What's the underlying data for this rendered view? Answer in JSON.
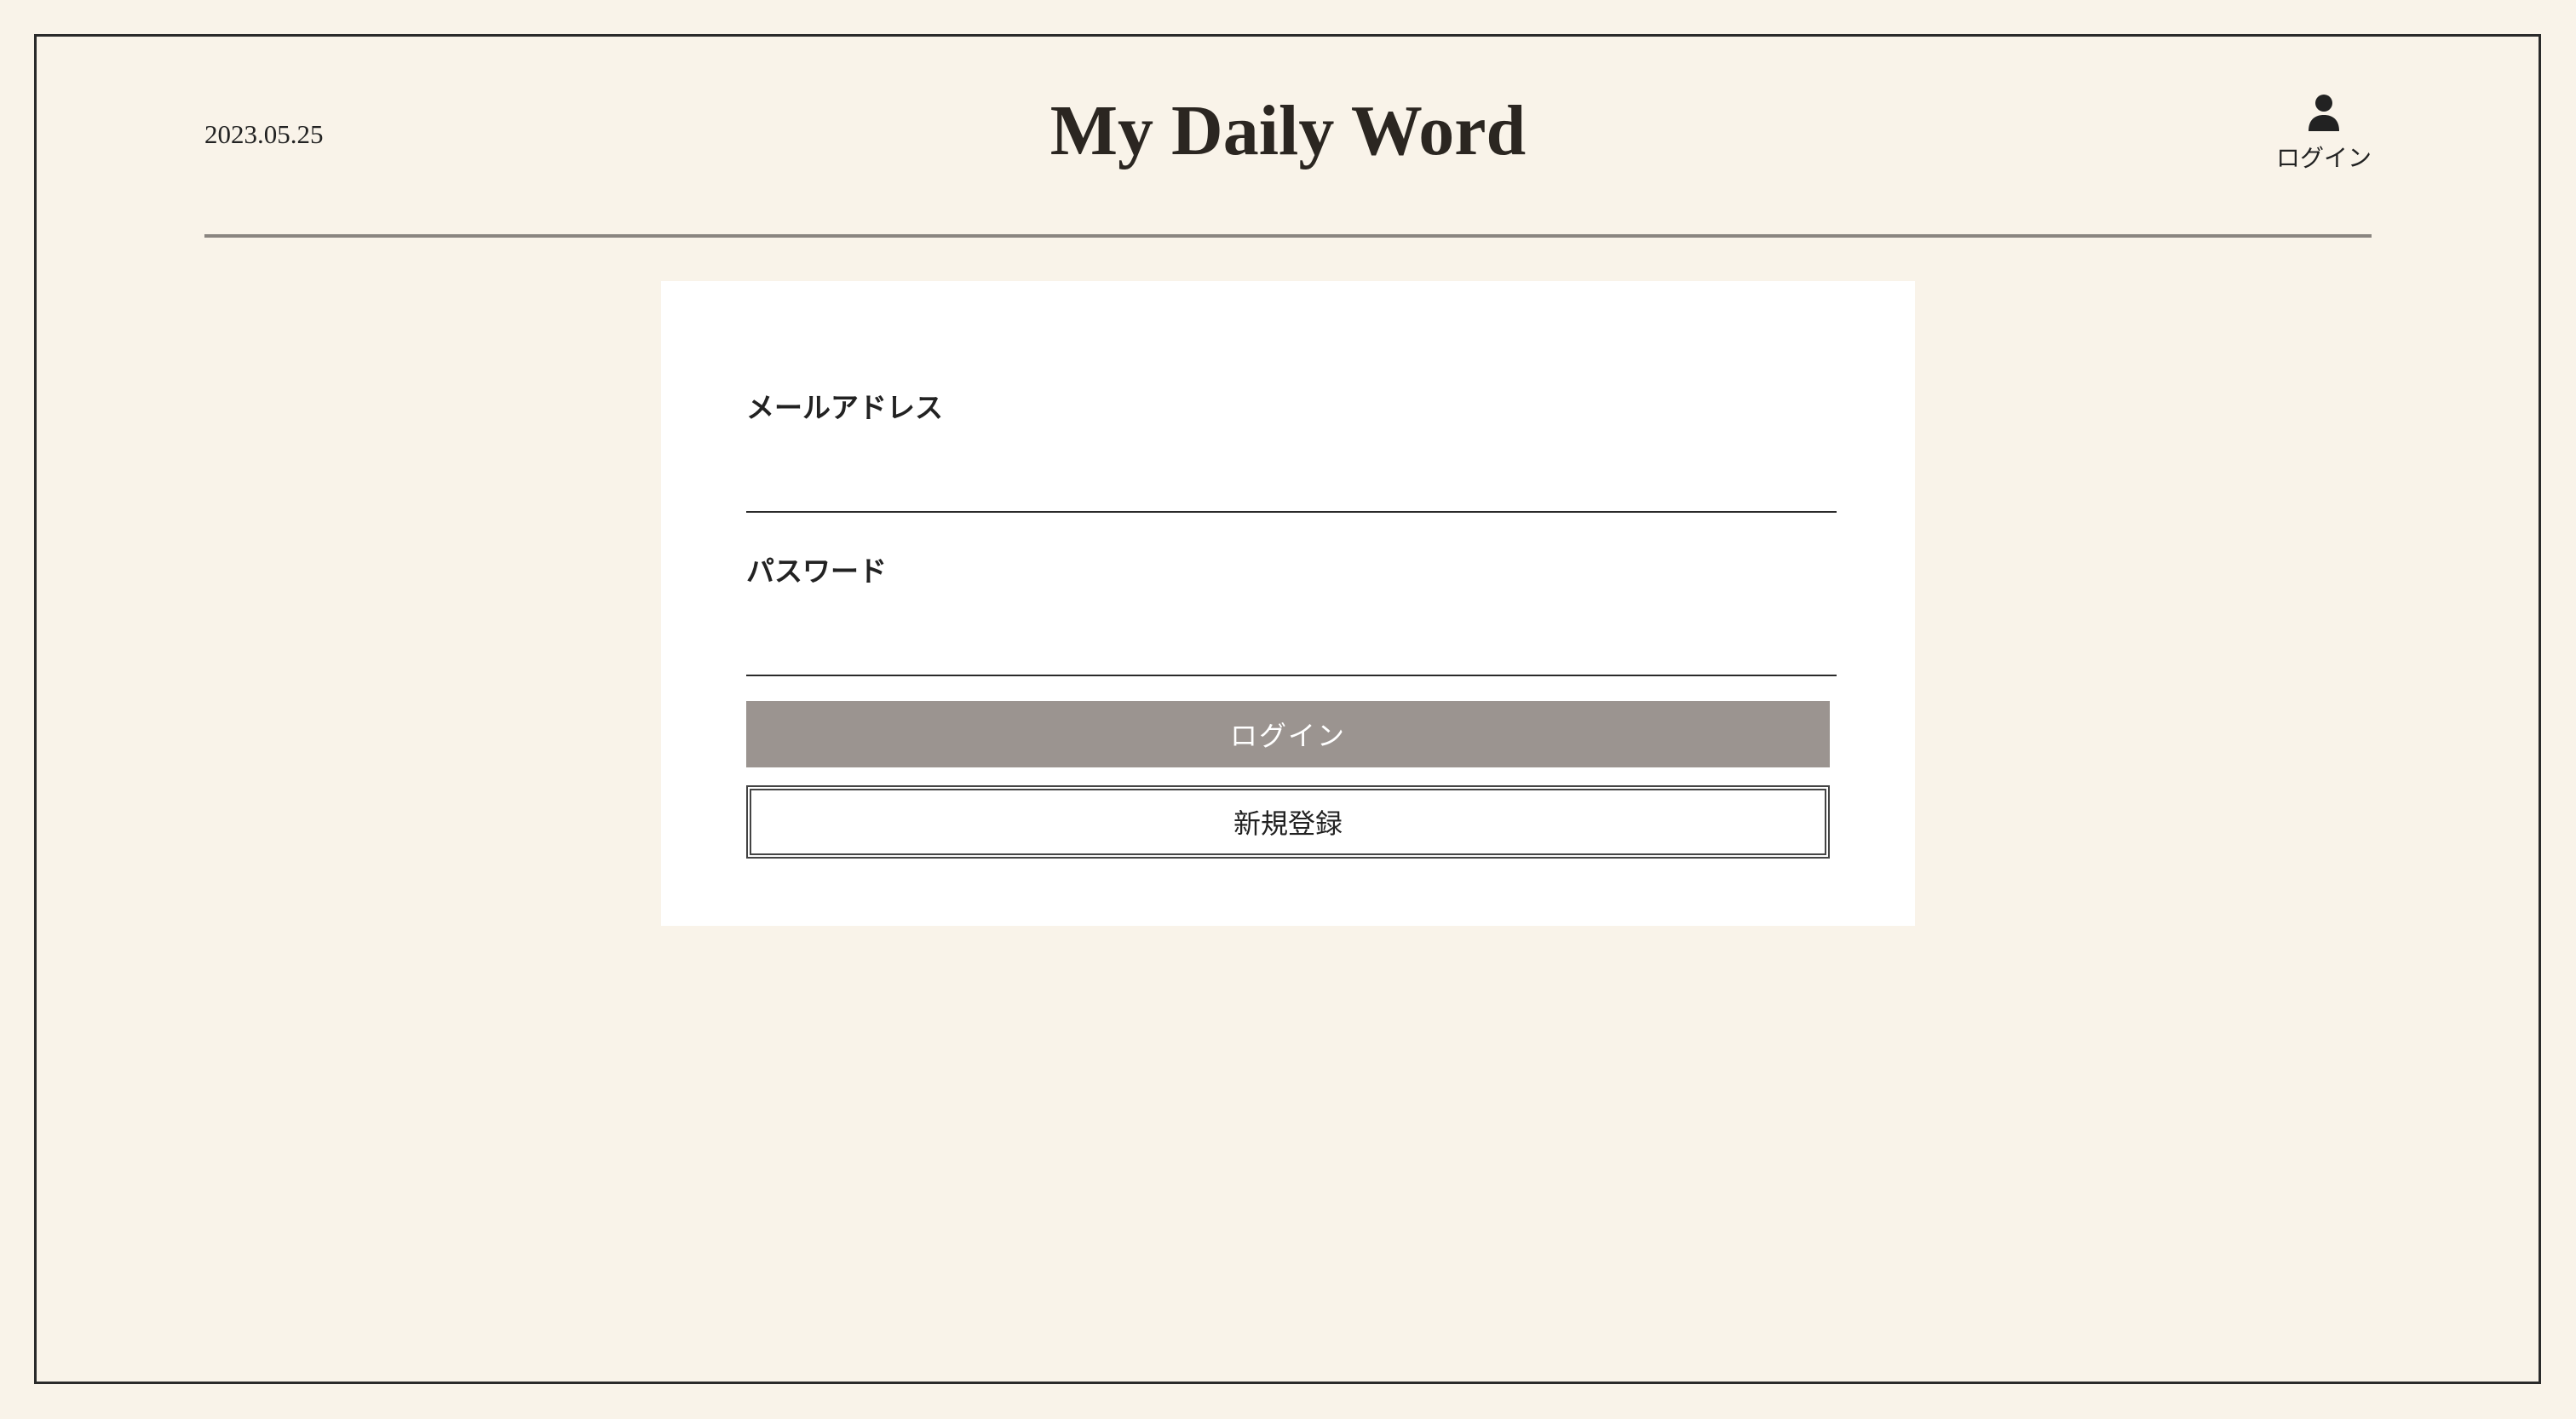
{
  "header": {
    "date": "2023.05.25",
    "title": "My Daily Word",
    "login_link_label": "ログイン",
    "login_icon": "user-icon"
  },
  "login_form": {
    "email_label": "メールアドレス",
    "email_value": "",
    "password_label": "パスワード",
    "password_value": "",
    "login_button_label": "ログイン",
    "register_button_label": "新規登録"
  },
  "colors": {
    "background": "#f9f3e9",
    "card": "#ffffff",
    "primary_button": "#9b9490",
    "text": "#222222"
  }
}
